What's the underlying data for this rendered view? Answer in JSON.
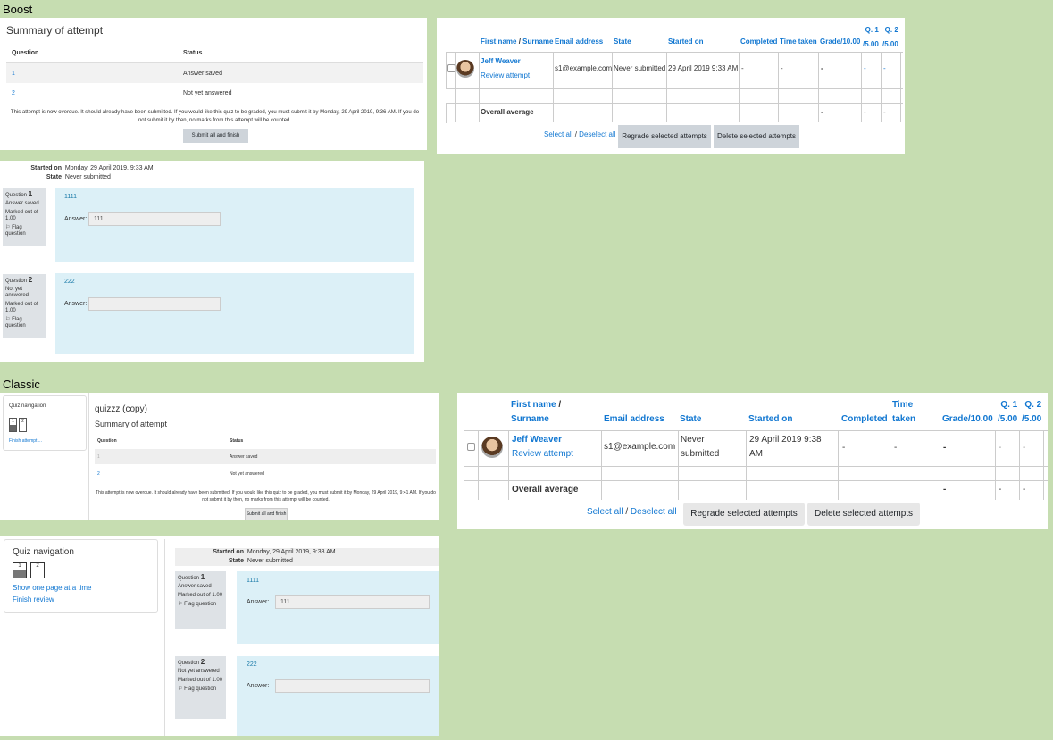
{
  "labels": {
    "boost": "Boost",
    "classic": "Classic"
  },
  "boost": {
    "summary": {
      "title": "Summary of attempt",
      "col_question": "Question",
      "col_status": "Status",
      "rows": [
        {
          "q": "1",
          "status": "Answer saved"
        },
        {
          "q": "2",
          "status": "Not yet answered"
        }
      ],
      "overdue_text": "This attempt is now overdue. It should already have been submitted. If you would like this quiz to be graded, you must submit it by Monday, 29 April 2019, 9:36 AM. If you do not submit it by then, no marks from this attempt will be counted.",
      "submit_label": "Submit all and finish"
    },
    "attempts": {
      "headers": {
        "first_name": "First name",
        "slash": "/",
        "surname": "Surname",
        "email": "Email address",
        "state": "State",
        "started": "Started on",
        "completed": "Completed",
        "time_taken": "Time taken",
        "grade": "Grade/10.00",
        "q1a": "Q. 1",
        "q1b": "/5.00",
        "q2a": "Q. 2",
        "q2b": "/5.00"
      },
      "row": {
        "name": "Jeff Weaver",
        "review": "Review attempt",
        "email": "s1@example.com",
        "state": "Never submitted",
        "started": "29 April 2019 9:33 AM",
        "completed": "-",
        "time_taken": "-",
        "grade": "-",
        "q1": "-",
        "q2": "-"
      },
      "average_label": "Overall average",
      "average_grade": "-",
      "average_q1": "-",
      "average_q2": "-",
      "select_all": "Select all",
      "slash": "/",
      "deselect_all": "Deselect all",
      "regrade": "Regrade selected attempts",
      "delete": "Delete selected attempts"
    },
    "review": {
      "started_label": "Started on",
      "started_value": "Monday, 29 April 2019, 9:33 AM",
      "state_label": "State",
      "state_value": "Never submitted",
      "questions": [
        {
          "label": "Question",
          "num": "1",
          "status": "Answer saved",
          "marked": "Marked out of 1.00",
          "flag": "Flag question",
          "text": "1111",
          "answer_label": "Answer:",
          "answer": "111"
        },
        {
          "label": "Question",
          "num": "2",
          "status": "Not yet answered",
          "marked": "Marked out of 1.00",
          "flag": "Flag question",
          "text": "222",
          "answer_label": "Answer:",
          "answer": ""
        }
      ]
    }
  },
  "classic": {
    "summary": {
      "nav_title": "Quiz navigation",
      "nav_buttons": [
        "1",
        "2"
      ],
      "finish_attempt": "Finish attempt ...",
      "quiz_name": "quizzz (copy)",
      "title": "Summary of attempt",
      "col_question": "Question",
      "col_status": "Status",
      "rows": [
        {
          "q": "1",
          "status": "Answer saved"
        },
        {
          "q": "2",
          "status": "Not yet answered"
        }
      ],
      "overdue_text": "This attempt is now overdue. It should already have been submitted. If you would like this quiz to be graded, you must submit it by Monday, 29 April 2019, 9:41 AM. If you do not submit it by then, no marks from this attempt will be counted.",
      "submit_label": "Submit all and finish"
    },
    "attempts": {
      "headers": {
        "first_name": "First name",
        "slash": "/",
        "surname": "Surname",
        "email": "Email address",
        "state": "State",
        "started": "Started on",
        "completed": "Completed",
        "time_a": "Time",
        "time_b": "taken",
        "grade": "Grade/10.00",
        "q1a": "Q. 1",
        "q1b": "/5.00",
        "q2a": "Q. 2",
        "q2b": "/5.00"
      },
      "row": {
        "name": "Jeff Weaver",
        "review": "Review attempt",
        "email": "s1@example.com",
        "state_a": "Never",
        "state_b": "submitted",
        "started_a": "29 April 2019 9:38",
        "started_b": "AM",
        "completed": "-",
        "time_taken": "-",
        "grade": "-",
        "q1": "-",
        "q2": "-"
      },
      "average_label": "Overall average",
      "average_grade": "-",
      "average_q1": "-",
      "average_q2": "-",
      "select_all": "Select all",
      "slash": "/",
      "deselect_all": "Deselect all",
      "regrade": "Regrade selected attempts",
      "delete": "Delete selected attempts"
    },
    "review": {
      "nav_title": "Quiz navigation",
      "nav_buttons": [
        "1",
        "2"
      ],
      "show_one_page": "Show one page at a time",
      "finish_review": "Finish review",
      "started_label": "Started on",
      "started_value": "Monday, 29 April 2019, 9:38 AM",
      "state_label": "State",
      "state_value": "Never submitted",
      "questions": [
        {
          "label": "Question",
          "num": "1",
          "status": "Answer saved",
          "marked": "Marked out of 1.00",
          "flag": "Flag question",
          "text": "1111",
          "answer_label": "Answer:",
          "answer": "111"
        },
        {
          "label": "Question",
          "num": "2",
          "status": "Not yet answered",
          "marked": "Marked out of 1.00",
          "flag": "Flag question",
          "text": "222",
          "answer_label": "Answer:",
          "answer": ""
        }
      ]
    }
  }
}
